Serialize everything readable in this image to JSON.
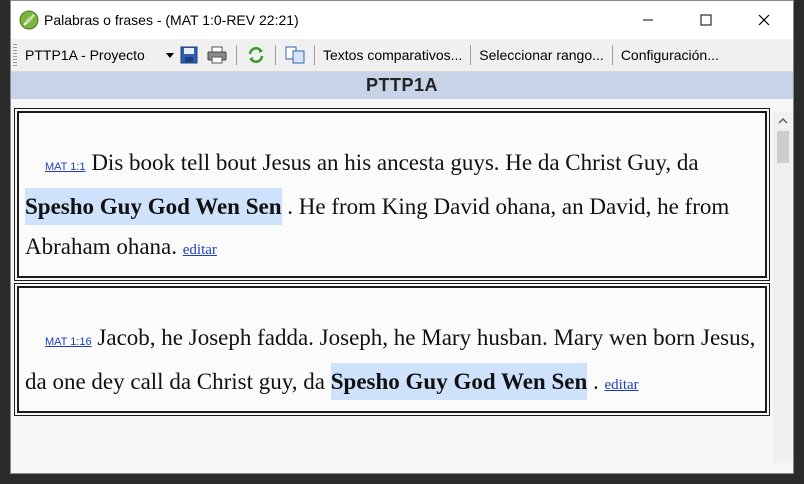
{
  "window": {
    "title": "Palabras o frases - (MAT 1:0-REV 22:21)"
  },
  "toolbar": {
    "project_select": "PTTP1A - Proyecto",
    "comparative_texts": "Textos comparativos...",
    "select_range": "Seleccionar rango...",
    "configuration": "Configuración..."
  },
  "header": {
    "title": "PTTP1A"
  },
  "entries": [
    {
      "ref": "MAT 1:1",
      "text_before": "Dis book tell bout Jesus an his ancesta guys. He da Christ Guy, da ",
      "highlight": "Spesho Guy God Wen Sen",
      "text_after": " . He from King David ohana, an David, he from Abraham ohana. ",
      "edit": "editar"
    },
    {
      "ref": "MAT 1:16",
      "text_before": "Jacob, he Joseph fadda. Joseph, he Mary husban. Mary wen born Jesus, da one dey call da Christ guy, da ",
      "highlight": "Spesho Guy God Wen Sen",
      "text_after": " . ",
      "edit": "editar"
    }
  ]
}
